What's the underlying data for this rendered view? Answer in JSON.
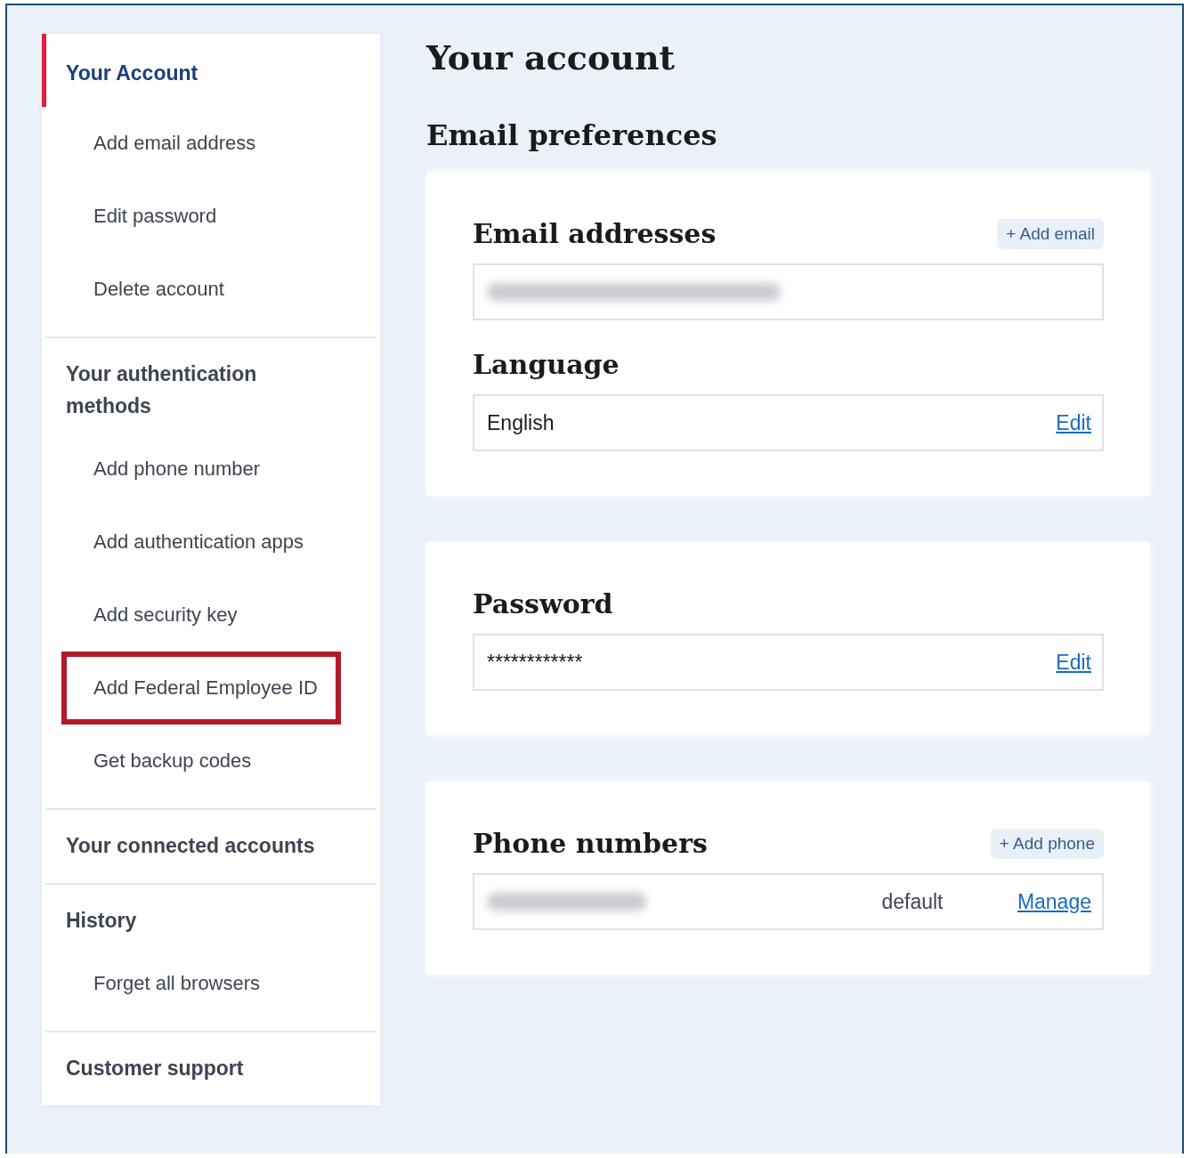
{
  "sidebar": {
    "sections": [
      {
        "heading": "Your Account",
        "selected": true,
        "items": [
          {
            "label": "Add email address",
            "highlighted": false
          },
          {
            "label": "Edit password",
            "highlighted": false
          },
          {
            "label": "Delete account",
            "highlighted": false
          }
        ]
      },
      {
        "heading": "Your authentication methods",
        "selected": false,
        "items": [
          {
            "label": "Add phone number",
            "highlighted": false
          },
          {
            "label": "Add authentication apps",
            "highlighted": false
          },
          {
            "label": "Add security key",
            "highlighted": false
          },
          {
            "label": "Add Federal Employee ID",
            "highlighted": true
          },
          {
            "label": "Get backup codes",
            "highlighted": false
          }
        ]
      },
      {
        "heading": "Your connected accounts",
        "selected": false
      },
      {
        "heading": "History",
        "selected": false,
        "items": [
          {
            "label": "Forget all browsers",
            "highlighted": false
          }
        ]
      },
      {
        "heading": "Customer support",
        "selected": false
      }
    ]
  },
  "main": {
    "title": "Your account",
    "subtitle": "Email preferences",
    "cards": [
      {
        "blocks": [
          {
            "kind": "redacted",
            "heading": "Email addresses",
            "action": "+ Add email"
          },
          {
            "kind": "value",
            "heading": "Language",
            "value": "English",
            "link": "Edit"
          }
        ]
      },
      {
        "blocks": [
          {
            "kind": "value",
            "heading": "Password",
            "value": "************",
            "link": "Edit"
          }
        ]
      },
      {
        "blocks": [
          {
            "kind": "phone",
            "heading": "Phone numbers",
            "action": "+ Add phone",
            "tag": "default",
            "link": "Manage"
          }
        ]
      }
    ]
  }
}
